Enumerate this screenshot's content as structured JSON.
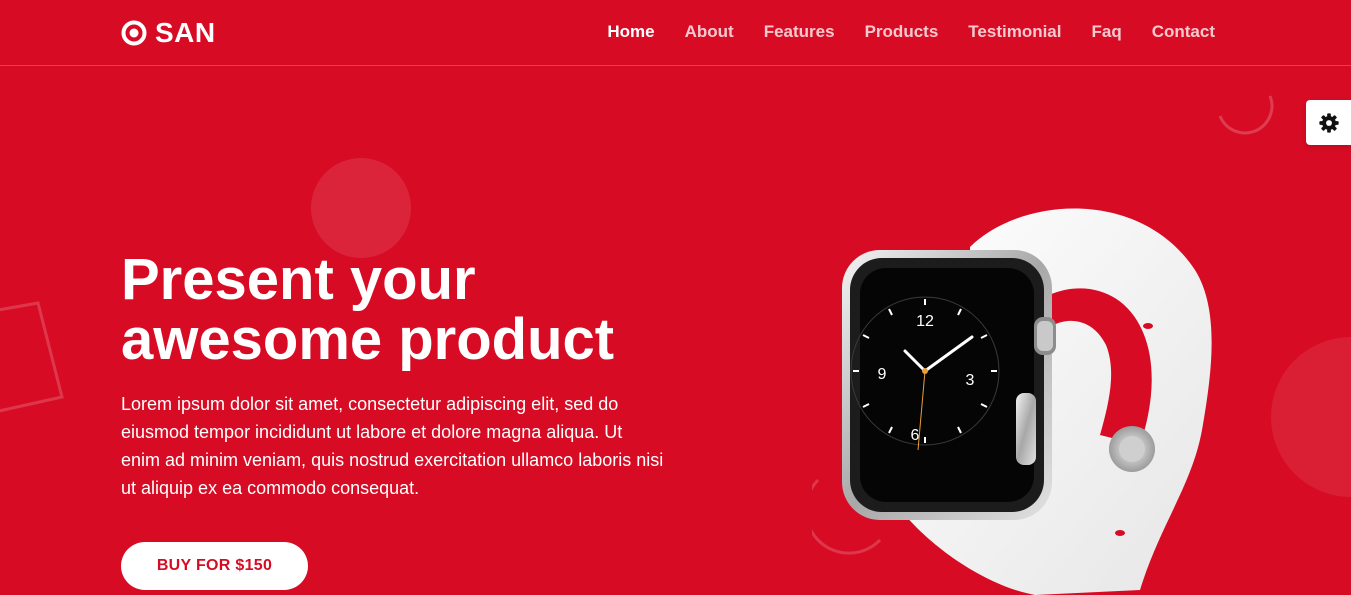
{
  "brand": {
    "name": "SAN",
    "icon": "target-icon"
  },
  "nav": {
    "items": [
      {
        "label": "Home",
        "active": true
      },
      {
        "label": "About",
        "active": false
      },
      {
        "label": "Features",
        "active": false
      },
      {
        "label": "Products",
        "active": false
      },
      {
        "label": "Testimonial",
        "active": false
      },
      {
        "label": "Faq",
        "active": false
      },
      {
        "label": "Contact",
        "active": false
      }
    ]
  },
  "settings": {
    "icon": "gear-icon"
  },
  "hero": {
    "title_line1": "Present your",
    "title_line2": "awesome product",
    "description": "Lorem ipsum dolor sit amet, consectetur adipiscing elit, sed do eiusmod tempor incididunt ut labore et dolore magna aliqua. Ut enim ad minim veniam, quis nostrud exercitation ullamco laboris nisi ut aliquip ex ea commodo consequat.",
    "cta_label": "BUY FOR $150"
  },
  "watch": {
    "numerals": [
      "12",
      "3",
      "6",
      "9"
    ]
  },
  "colors": {
    "primary": "#d70c24",
    "white": "#ffffff"
  }
}
